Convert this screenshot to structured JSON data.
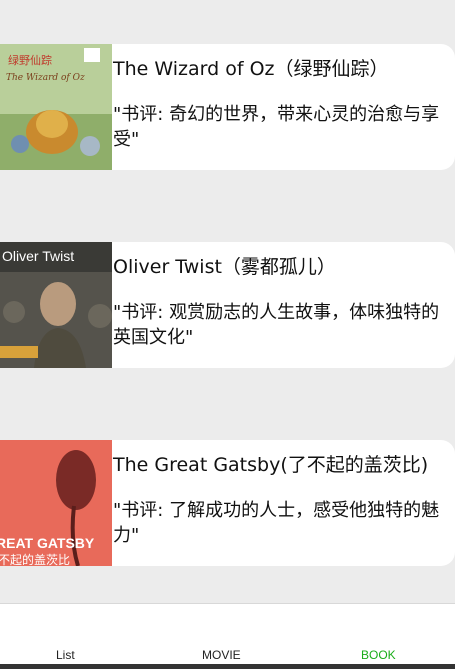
{
  "books": [
    {
      "title": "The Wizard of Oz（绿野仙踪）",
      "review": "\"书评: 奇幻的世界，带来心灵的治愈与享受\"",
      "cover_text": [
        "绿野仙踪",
        "The Wizard of Oz"
      ]
    },
    {
      "title": "Oliver Twist（雾都孤儿）",
      "review": "\"书评: 观赏励志的人生故事，体味独特的英国文化\"",
      "cover_text": [
        "Oliver Twist"
      ]
    },
    {
      "title": "The Great Gatsby(了不起的盖茨比)",
      "review": "\"书评: 了解成功的人士，感受他独特的魅力\"",
      "cover_text": [
        "REAT GATSBY",
        "不起的盖茨比"
      ]
    }
  ],
  "tabbar": {
    "tabs": [
      "List",
      "MOVIE",
      "BOOK"
    ],
    "active": "BOOK",
    "active_color": "#1aad19"
  }
}
